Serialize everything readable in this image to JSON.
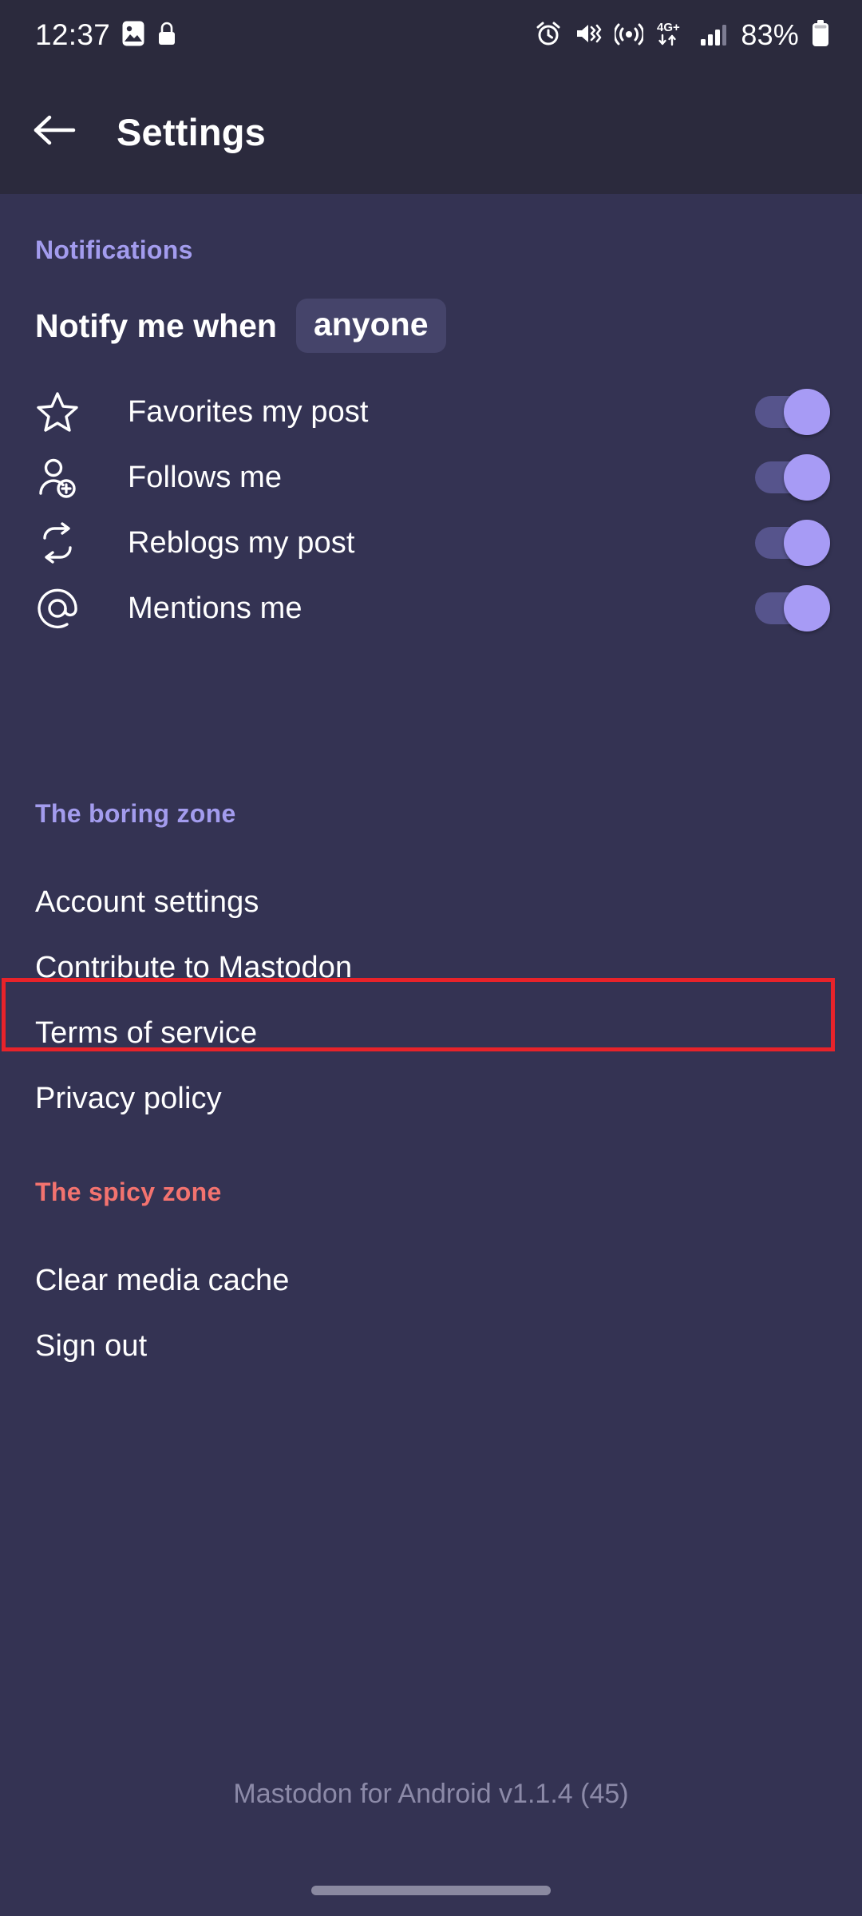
{
  "statusbar": {
    "time": "12:37",
    "left_icons": [
      "image-icon",
      "lock-icon"
    ],
    "right_icons": [
      "alarm-icon",
      "vibrate-mute-icon",
      "hotspot-icon",
      "network-4g-plus-icon",
      "signal-bars-icon"
    ],
    "battery_percent": "83%",
    "network_label": "4G+"
  },
  "appbar": {
    "back_icon": "arrow-left-icon",
    "title": "Settings"
  },
  "sections": {
    "notifications": {
      "header": "Notifications",
      "notify_label": "Notify me when",
      "notify_value": "anyone",
      "items": [
        {
          "icon": "star-icon",
          "label": "Favorites my post",
          "enabled": "on"
        },
        {
          "icon": "person-add-icon",
          "label": "Follows me",
          "enabled": "on"
        },
        {
          "icon": "boost-icon",
          "label": "Reblogs my post",
          "enabled": "on"
        },
        {
          "icon": "at-icon",
          "label": "Mentions me",
          "enabled": "on"
        }
      ]
    },
    "boring_zone": {
      "header": "The boring zone",
      "items": [
        {
          "label": "Account settings"
        },
        {
          "label": "Contribute to Mastodon"
        },
        {
          "label": "Terms of service"
        },
        {
          "label": "Privacy policy"
        }
      ]
    },
    "spicy_zone": {
      "header": "The spicy zone",
      "items": [
        {
          "label": "Clear media cache"
        },
        {
          "label": "Sign out"
        }
      ]
    }
  },
  "footer": {
    "version": "Mastodon for Android v1.1.4 (45)"
  },
  "colors": {
    "statusbar_bg": "#2B2A3D",
    "body_bg": "#343353",
    "accent_purple": "#A39CEE",
    "danger_red": "#F3736F",
    "switch_thumb": "#A79BF5",
    "switch_track": "#56548C",
    "chip_bg": "#45446A",
    "annotation_red": "#E8232A"
  },
  "annotation": {
    "target": "Account settings",
    "color": "#E8232A"
  }
}
